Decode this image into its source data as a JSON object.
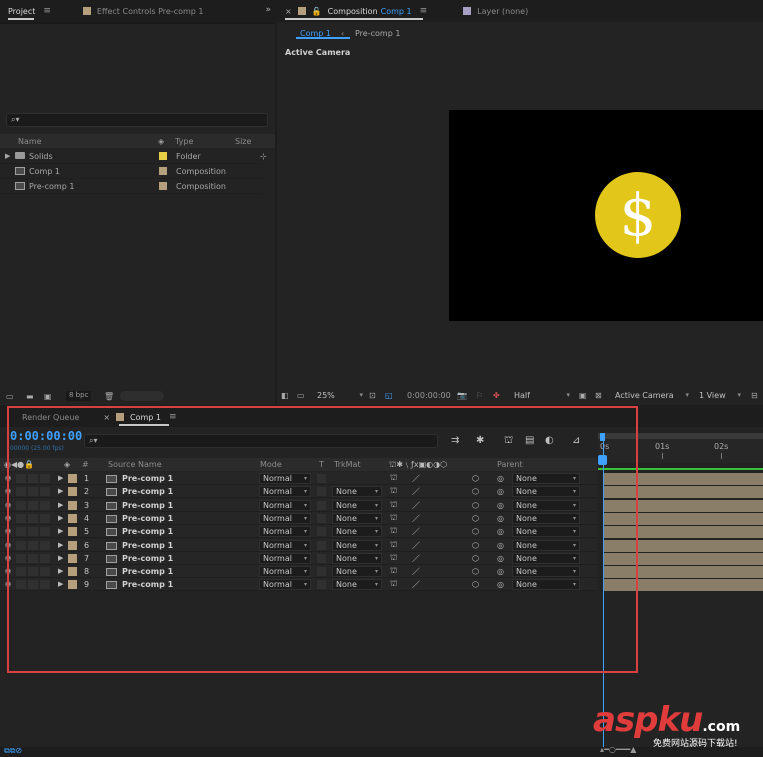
{
  "project": {
    "tab_label": "Project",
    "effect_controls_label": "Effect Controls Pre-comp 1",
    "columns": [
      "Name",
      "Type",
      "Size"
    ],
    "items": [
      {
        "name": "Solids",
        "type": "Folder",
        "icon": "folder-icon",
        "swatch": "#e6d146"
      },
      {
        "name": "Comp 1",
        "type": "Composition",
        "icon": "composition-icon",
        "swatch": "#b59f7d"
      },
      {
        "name": "Pre-comp 1",
        "type": "Composition",
        "icon": "composition-icon",
        "swatch": "#b59f7d"
      }
    ],
    "bpc_label": "8 bpc"
  },
  "viewer": {
    "tab_prefix": "Composition",
    "tab_comp": "Comp 1",
    "layer_tab": "Layer (none)",
    "subtabs": [
      "Comp 1",
      "Pre-comp 1"
    ],
    "camera_label": "Active Camera",
    "coin_symbol": "$",
    "zoom": "25%",
    "timecode": "0:00:00:00",
    "resolution": "Half",
    "camera_select": "Active Camera",
    "view_select": "1 View"
  },
  "timeline": {
    "render_queue_tab": "Render Queue",
    "comp_tab": "Comp 1",
    "timecode": "0:00:00:00",
    "fps_label": "00000 (25.00 fps)",
    "columns": {
      "source_name": "Source Name",
      "number": "#",
      "mode": "Mode",
      "t": "T",
      "trkmat": "TrkMat",
      "parent": "Parent"
    },
    "ruler_ticks": [
      "0s",
      "01s",
      "02s"
    ],
    "layers": [
      {
        "num": "1",
        "name": "Pre-comp 1",
        "mode": "Normal",
        "trkmat": "",
        "parent": "None"
      },
      {
        "num": "2",
        "name": "Pre-comp 1",
        "mode": "Normal",
        "trkmat": "None",
        "parent": "None"
      },
      {
        "num": "3",
        "name": "Pre-comp 1",
        "mode": "Normal",
        "trkmat": "None",
        "parent": "None"
      },
      {
        "num": "4",
        "name": "Pre-comp 1",
        "mode": "Normal",
        "trkmat": "None",
        "parent": "None"
      },
      {
        "num": "5",
        "name": "Pre-comp 1",
        "mode": "Normal",
        "trkmat": "None",
        "parent": "None"
      },
      {
        "num": "6",
        "name": "Pre-comp 1",
        "mode": "Normal",
        "trkmat": "None",
        "parent": "None"
      },
      {
        "num": "7",
        "name": "Pre-comp 1",
        "mode": "Normal",
        "trkmat": "None",
        "parent": "None"
      },
      {
        "num": "8",
        "name": "Pre-comp 1",
        "mode": "Normal",
        "trkmat": "None",
        "parent": "None"
      },
      {
        "num": "9",
        "name": "Pre-comp 1",
        "mode": "Normal",
        "trkmat": "None",
        "parent": "None"
      }
    ],
    "layer_swatch": "#b59f7d"
  },
  "watermark": {
    "brand": "aspku",
    "tld": ".com",
    "tagline": "免费网站源码下载站!"
  },
  "colors": {
    "accent": "#3ea1ff",
    "highlight_box": "#d8413f",
    "coin": "#e2c61a"
  }
}
